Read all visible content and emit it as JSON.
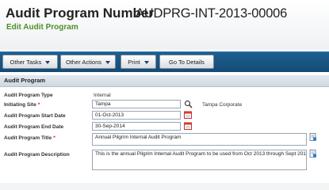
{
  "header": {
    "title_label": "Audit Program Number",
    "title_value": "AUDPRG-INT-2013-00006",
    "subtitle": "Edit Audit Program"
  },
  "toolbar": {
    "other_tasks": "Other Tasks",
    "other_actions": "Other Actions",
    "print": "Print",
    "go_to_details": "Go To Details"
  },
  "section": {
    "title": "Audit Program"
  },
  "form": {
    "program_type_label": "Audit Program Type",
    "program_type_value": "Internal",
    "initiating_site_label": "Initiating Site",
    "initiating_site_value": "Tampa",
    "initiating_site_display": "Tampa Corporate",
    "start_date_label": "Audit Program Start Date",
    "start_date_value": "01-Oct-2013",
    "end_date_label": "Audit Program End Date",
    "end_date_value": "30-Sep-2014",
    "program_title_label": "Audit Program Title",
    "program_title_value": "Annual Pilgrim Internal Audit Program",
    "description_label": "Audit Program Description",
    "description_value": "This is the annual Pilgrim Internal Audit Program to be used from Oct 2013 through Sept 2014."
  },
  "colors": {
    "toolbar": "#154a74",
    "subtitle": "#4e8f2a",
    "required": "#cc1d1d"
  },
  "icons": [
    "search-icon",
    "calendar-icon",
    "edit-note-icon",
    "chevron-down-icon"
  ]
}
